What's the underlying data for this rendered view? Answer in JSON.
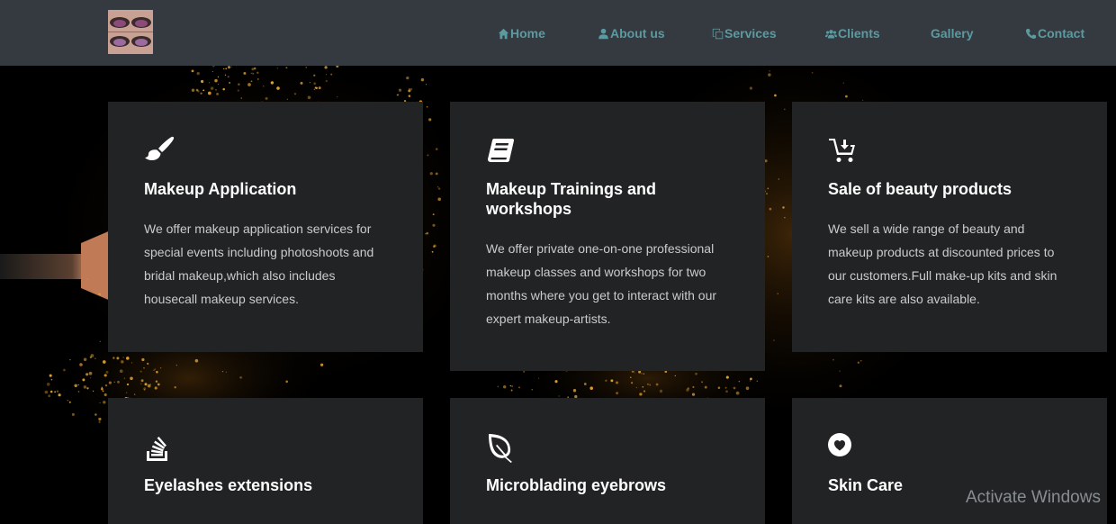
{
  "nav": {
    "logo_alt": "eye makeup",
    "items": [
      {
        "label": "Home",
        "icon": "home-icon"
      },
      {
        "label": "About us",
        "icon": "user-icon"
      },
      {
        "label": "Services",
        "icon": "copy-icon"
      },
      {
        "label": "Clients",
        "icon": "users-icon"
      },
      {
        "label": "Gallery",
        "icon": ""
      },
      {
        "label": "Contact",
        "icon": "phone-icon"
      }
    ],
    "color": "#5b9aa0"
  },
  "services": [
    {
      "title": "Makeup Application",
      "icon": "brush-icon",
      "text": "We offer makeup application services for special events including photoshoots and bridal makeup,which also includes housecall makeup services."
    },
    {
      "title": "Makeup Trainings and workshops",
      "icon": "book-icon",
      "text": "We offer private one-on-one professional makeup classes and workshops for two months where you get to interact with our expert makeup-artists."
    },
    {
      "title": "Sale of beauty products",
      "icon": "cart-download-icon",
      "text": "We sell a wide range of beauty and makeup products at discounted prices to our customers.Full make-up kits and skin care kits are also available."
    },
    {
      "title": "Eyelashes extensions",
      "icon": "stack-overflow-icon",
      "text": ""
    },
    {
      "title": "Microblading eyebrows",
      "icon": "leaf-icon",
      "text": ""
    },
    {
      "title": "Skin Care",
      "icon": "heart-circle-icon",
      "text": ""
    }
  ],
  "watermark": "Activate Windows",
  "colors": {
    "navbar": "#343a40",
    "card": "#212324",
    "sparkle": "#e0a030"
  }
}
